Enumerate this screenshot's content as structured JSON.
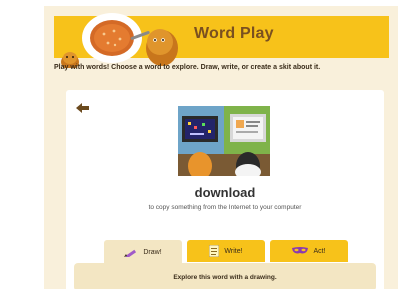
{
  "header": {
    "title": "Word Play",
    "art_icon": "pie-and-character-illustration"
  },
  "intro": "Play with words! Choose a word to explore. Draw, write, or create a skit about it.",
  "card": {
    "back_icon": "arrow-left-icon",
    "word": "download",
    "definition": "to copy something from the Internet to your computer",
    "illustration_icon": "kids-at-computers-illustration"
  },
  "tabs": [
    {
      "label": "Draw!",
      "icon": "pencil-icon",
      "active": true
    },
    {
      "label": "Write!",
      "icon": "notepad-icon",
      "active": false
    },
    {
      "label": "Act!",
      "icon": "mask-icon",
      "active": false
    }
  ],
  "panel": {
    "text": "Explore this word with a drawing."
  },
  "colors": {
    "banner": "#f7c21a",
    "page_bg": "#f9f0db",
    "active_tab": "#f3e6c3",
    "title_text": "#7a5020"
  }
}
